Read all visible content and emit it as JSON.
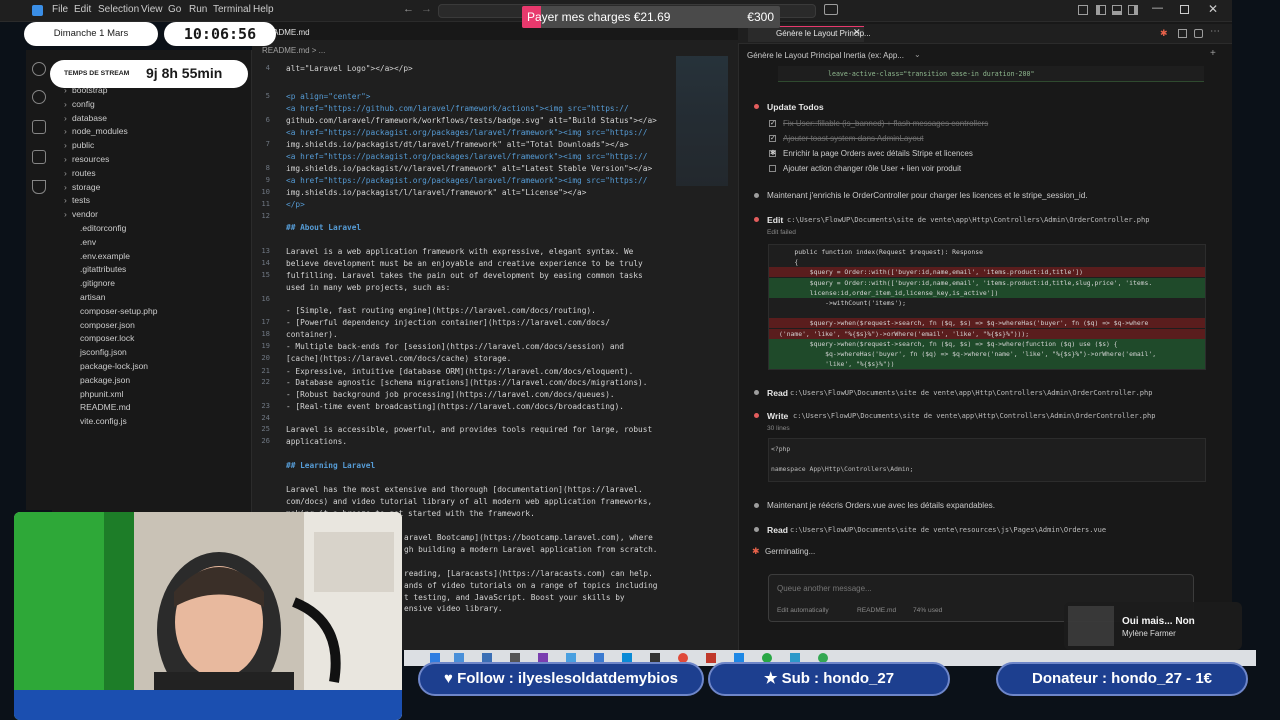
{
  "window": {
    "menu": [
      "File",
      "Edit",
      "Selection",
      "View",
      "Go",
      "Run",
      "Terminal",
      "Help"
    ]
  },
  "editor": {
    "tabs": [
      "README.md"
    ],
    "breadcrumb": "README.md > ...",
    "line_numbers": [
      "4",
      "5",
      "",
      "6",
      "",
      "7",
      "",
      "8",
      "9",
      "10",
      "11",
      "12",
      "",
      "",
      "13",
      "14",
      "15",
      "",
      "16",
      "",
      "17",
      "18",
      "19",
      "20",
      "21",
      "22",
      "",
      "23",
      "24",
      "25",
      "26"
    ],
    "lines": [
      "alt=\"Laravel Logo\"></a></p>",
      "<p align=\"center\">",
      "<a href=\"https://github.com/laravel/framework/actions\"><img src=\"https://",
      "github.com/laravel/framework/workflows/tests/badge.svg\" alt=\"Build Status\"></a>",
      "<a href=\"https://packagist.org/packages/laravel/framework\"><img src=\"https://",
      "img.shields.io/packagist/dt/laravel/framework\" alt=\"Total Downloads\"></a>",
      "<a href=\"https://packagist.org/packages/laravel/framework\"><img src=\"https://",
      "img.shields.io/packagist/v/laravel/framework\" alt=\"Latest Stable Version\"></a>",
      "<a href=\"https://packagist.org/packages/laravel/framework\"><img src=\"https://",
      "img.shields.io/packagist/l/laravel/framework\" alt=\"License\"></a>",
      "</p>",
      "## About Laravel",
      "Laravel is a web application framework with expressive, elegant syntax. We",
      "believe development must be an enjoyable and creative experience to be truly",
      "fulfilling. Laravel takes the pain out of development by easing common tasks",
      "used in many web projects, such as:",
      "- [Simple, fast routing engine](https://laravel.com/docs/routing).",
      "- [Powerful dependency injection container](https://laravel.com/docs/",
      "container).",
      "- Multiple back-ends for [session](https://laravel.com/docs/session) and",
      "[cache](https://laravel.com/docs/cache) storage.",
      "- Expressive, intuitive [database ORM](https://laravel.com/docs/eloquent).",
      "- Database agnostic [schema migrations](https://laravel.com/docs/migrations).",
      "- [Robust background job processing](https://laravel.com/docs/queues).",
      "- [Real-time event broadcasting](https://laravel.com/docs/broadcasting).",
      "Laravel is accessible, powerful, and provides tools required for large, robust",
      "applications.",
      "## Learning Laravel",
      "Laravel has the most extensive and thorough [documentation](https://laravel.",
      "com/docs) and video tutorial library of all modern web application frameworks,",
      "making it a breeze to get started with the framework.",
      "aravel Bootcamp](https://bootcamp.laravel.com), where",
      "gh building a modern Laravel application from scratch.",
      "reading, [Laracasts](https://laracasts.com) can help.",
      "ands of video tutorials on a range of topics including",
      "t testing, and JavaScript. Boost your skills by",
      "ensive video library."
    ]
  },
  "explorer": {
    "items": [
      {
        "label": "bootstrap",
        "folder": true
      },
      {
        "label": "config",
        "folder": true
      },
      {
        "label": "database",
        "folder": true
      },
      {
        "label": "node_modules",
        "folder": true
      },
      {
        "label": "public",
        "folder": true
      },
      {
        "label": "resources",
        "folder": true
      },
      {
        "label": "routes",
        "folder": true
      },
      {
        "label": "storage",
        "folder": true
      },
      {
        "label": "tests",
        "folder": true
      },
      {
        "label": "vendor",
        "folder": true
      },
      {
        "label": ".editorconfig",
        "folder": false
      },
      {
        "label": ".env",
        "folder": false
      },
      {
        "label": ".env.example",
        "folder": false
      },
      {
        "label": ".gitattributes",
        "folder": false
      },
      {
        "label": ".gitignore",
        "folder": false
      },
      {
        "label": "artisan",
        "folder": false
      },
      {
        "label": "composer-setup.php",
        "folder": false
      },
      {
        "label": "composer.json",
        "folder": false
      },
      {
        "label": "composer.lock",
        "folder": false
      },
      {
        "label": "jsconfig.json",
        "folder": false
      },
      {
        "label": "package-lock.json",
        "folder": false
      },
      {
        "label": "package.json",
        "folder": false
      },
      {
        "label": "phpunit.xml",
        "folder": false
      },
      {
        "label": "README.md",
        "folder": false
      },
      {
        "label": "vite.config.js",
        "folder": false
      }
    ]
  },
  "chat": {
    "tab_title": "Génère le Layout Princip...",
    "session_title": "Génère le Layout Principal Inertia (ex: App...",
    "code_snippet_top": "leave-active-class=\"transition ease-in duration-200\"",
    "update_todos": "Update Todos",
    "todos": [
      {
        "label": "Fix User::fillable (is_banned) + flash messages controllers",
        "done": true
      },
      {
        "label": "Ajouter toast system dans AdminLayout",
        "done": true
      },
      {
        "label": "Enrichir la page Orders avec détails Stripe et licences",
        "active": true
      },
      {
        "label": "Ajouter action changer rôle User + lien voir produit",
        "done": false
      }
    ],
    "msg1": "Maintenant j'enrichis le OrderController pour charger les licences et le stripe_session_id.",
    "edit_label": "Edit",
    "edit_path": "c:\\Users\\FlowUP\\Documents\\site de vente\\app\\Http\\Controllers\\Admin\\OrderController.php",
    "edit_status": "Edit failed",
    "diff_lines": [
      {
        "text": "    public function index(Request $request): Response",
        "type": "ctx"
      },
      {
        "text": "    {",
        "type": "ctx"
      },
      {
        "text": "        $query = Order::with(['buyer:id,name,email', 'items.product:id,title'])",
        "type": "del"
      },
      {
        "text": "        $query = Order::with(['buyer:id,name,email', 'items.product:id,title,slug,price', 'items.",
        "type": "add"
      },
      {
        "text": "        license:id,order_item_id,license_key,is_active'])",
        "type": "add"
      },
      {
        "text": "            ->withCount('items');",
        "type": "ctx"
      },
      {
        "text": "",
        "type": "ctx"
      },
      {
        "text": "        $query->when($request->search, fn ($q, $s) => $q->whereHas('buyer', fn ($q) => $q->where",
        "type": "del"
      },
      {
        "text": "('name', 'like', \"%{$s}%\")->orWhere('email', 'like', \"%{$s}%\")));",
        "type": "del"
      },
      {
        "text": "        $query->when($request->search, fn ($q, $s) => $q->where(function ($q) use ($s) {",
        "type": "add"
      },
      {
        "text": "            $q->whereHas('buyer', fn ($q) => $q->where('name', 'like', \"%{$s}%\")->orWhere('email',",
        "type": "add"
      },
      {
        "text": "            'like', \"%{$s}%\"))",
        "type": "add"
      }
    ],
    "read1_label": "Read",
    "read1_path": "c:\\Users\\FlowUP\\Documents\\site de vente\\app\\Http\\Controllers\\Admin\\OrderController.php",
    "write_label": "Write",
    "write_path": "c:\\Users\\FlowUP\\Documents\\site de vente\\app\\Http\\Controllers\\Admin\\OrderController.php",
    "write_lines": "30 lines",
    "write_code_1": "<?php",
    "write_code_2": "namespace App\\Http\\Controllers\\Admin;",
    "msg2": "Maintenant je réécris Orders.vue avec les détails expandables.",
    "read2_label": "Read",
    "read2_path": "c:\\Users\\FlowUP\\Documents\\site de vente\\resources\\js\\Pages\\Admin\\Orders.vue",
    "status": "Germinating...",
    "placeholder": "Queue another message...",
    "footer_edit": "Edit automatically",
    "footer_file": "README.md",
    "footer_usage": "74% used"
  },
  "overlay": {
    "date": "Dimanche 1 Mars",
    "clock": "10:06:56",
    "stream_label": "TEMPS DE STREAM",
    "stream_time": "9j 8h 55min",
    "pay_label": "Payer mes charges €21.69",
    "pay_goal": "€300",
    "pay_progress": 0.072,
    "follow": "Follow : ilyeslesoldatdemybios",
    "sub": "Sub : hondo_27",
    "donor": "Donateur : hondo_27 - 1€",
    "song_title": "Oui mais... Non",
    "song_artist": "Mylène Farmer"
  },
  "colors": {
    "accent_blue": "#1d3f8f",
    "pay_fill": "#e8396d",
    "diff_del": "#5a1d1d",
    "diff_add": "#1f4a2a"
  }
}
